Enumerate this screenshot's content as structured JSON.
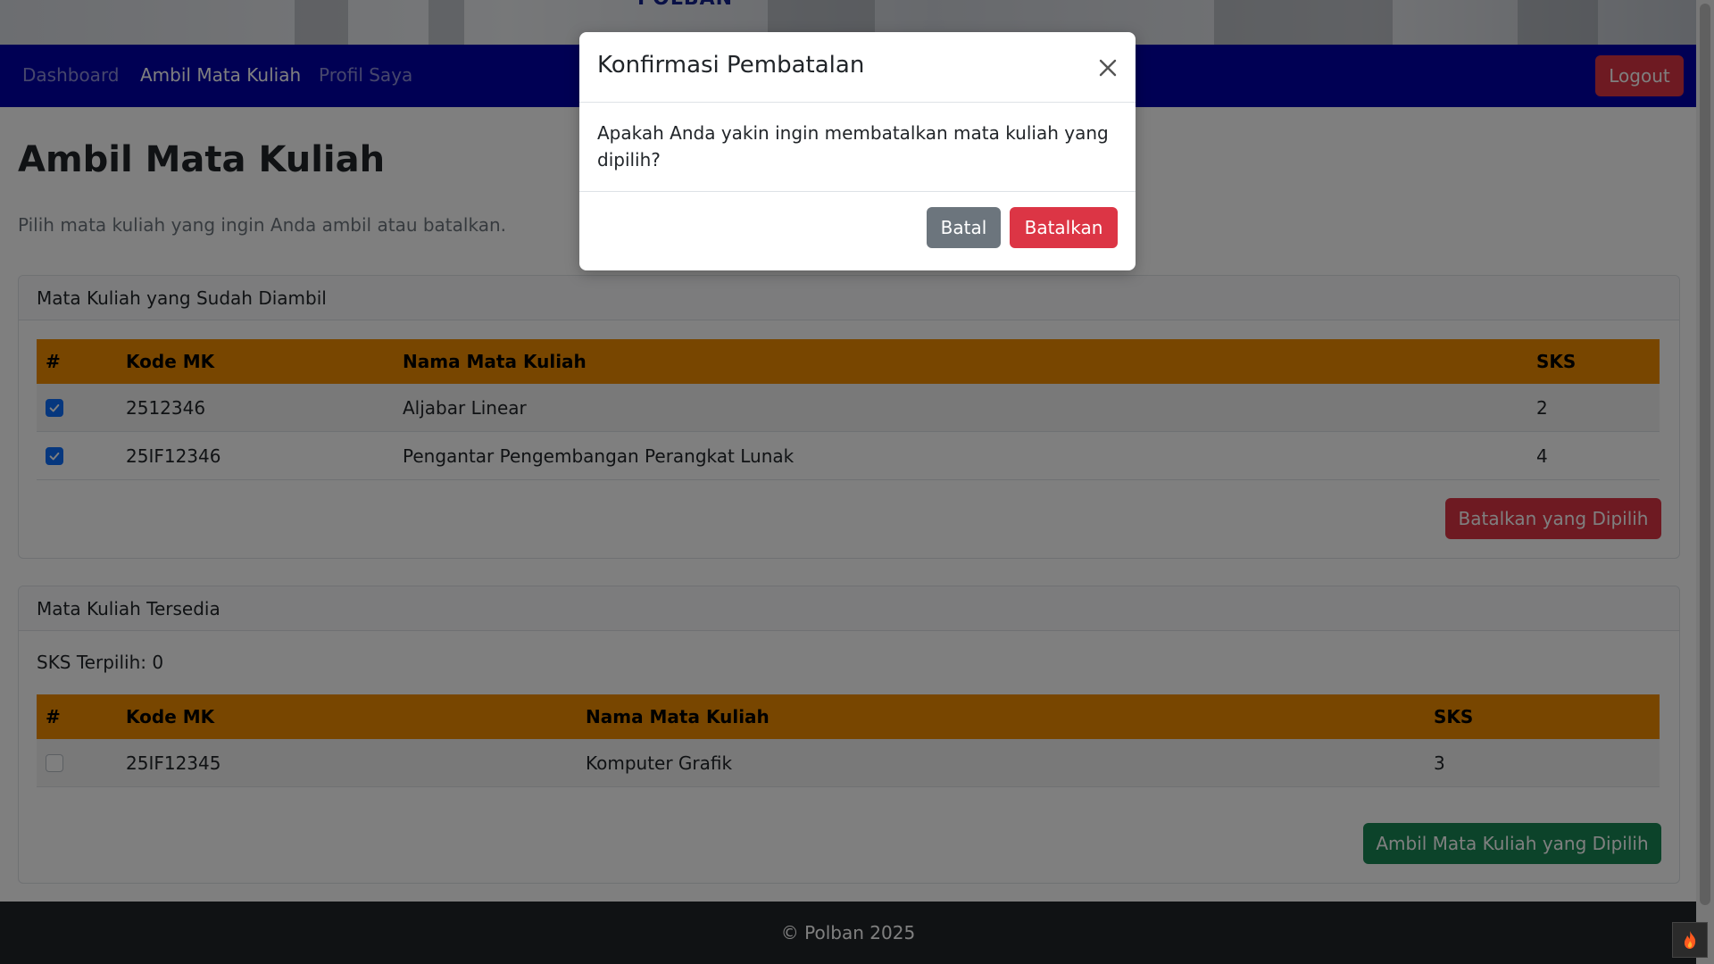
{
  "banner": {
    "logo_text": "POLBAN"
  },
  "navbar": {
    "links": [
      {
        "label": "Dashboard",
        "active": false
      },
      {
        "label": "Ambil Mata Kuliah",
        "active": true
      },
      {
        "label": "Profil Saya",
        "active": false
      }
    ],
    "logout_label": "Logout"
  },
  "main": {
    "title": "Ambil Mata Kuliah",
    "lead": "Pilih mata kuliah yang ingin Anda ambil atau batalkan."
  },
  "taken_card": {
    "header": "Mata Kuliah yang Sudah Diambil",
    "columns": [
      "#",
      "Kode MK",
      "Nama Mata Kuliah",
      "SKS"
    ],
    "rows": [
      {
        "checked": true,
        "kode": "2512346",
        "nama": "Aljabar Linear",
        "sks": "2"
      },
      {
        "checked": true,
        "kode": "25IF12346",
        "nama": "Pengantar Pengembangan Perangkat Lunak",
        "sks": "4"
      }
    ],
    "action_label": "Batalkan yang Dipilih"
  },
  "available_card": {
    "header": "Mata Kuliah Tersedia",
    "sks_selected": "SKS Terpilih: 0",
    "columns": [
      "#",
      "Kode MK",
      "Nama Mata Kuliah",
      "SKS"
    ],
    "rows": [
      {
        "checked": false,
        "kode": "25IF12345",
        "nama": "Komputer Grafik",
        "sks": "3"
      }
    ],
    "action_label": "Ambil Mata Kuliah yang Dipilih"
  },
  "footer": {
    "text": "© Polban 2025"
  },
  "modal": {
    "title": "Konfirmasi Pembatalan",
    "body": "Apakah Anda yakin ingin membatalkan mata kuliah yang dipilih?",
    "cancel_label": "Batal",
    "confirm_label": "Batalkan"
  },
  "colors": {
    "navbar": "#0000a8",
    "table_header": "#f08c00",
    "danger": "#dc3545",
    "success": "#198754",
    "secondary": "#6c757d",
    "footer": "#212529"
  },
  "icons": {
    "modal_close": "close-icon",
    "checkbox": "check-icon",
    "corner_badge": "fire-icon"
  }
}
